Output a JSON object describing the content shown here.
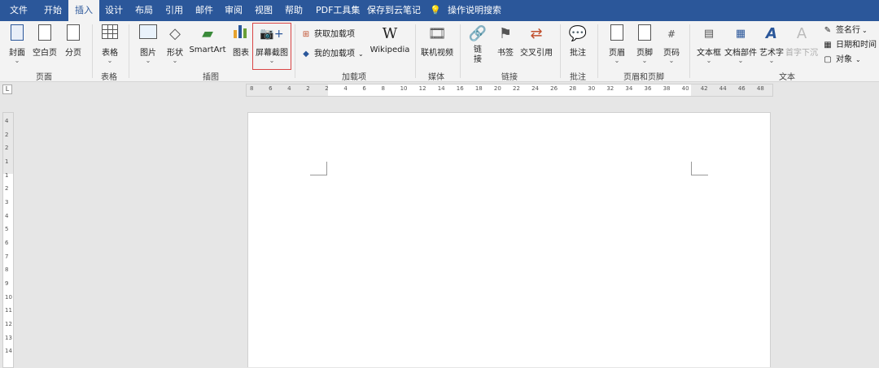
{
  "menu": {
    "file": "文件",
    "home": "开始",
    "insert": "插入",
    "design": "设计",
    "layout": "布局",
    "references": "引用",
    "mailings": "邮件",
    "review": "审阅",
    "view": "视图",
    "help": "帮助",
    "pdf": "PDF工具集",
    "save_cloud": "保存到云笔记",
    "search": "操作说明搜索"
  },
  "ribbon": {
    "pages": {
      "cover": "封面",
      "blank": "空白页",
      "break": "分页",
      "label": "页面"
    },
    "tables": {
      "table": "表格",
      "label": "表格"
    },
    "illustrations": {
      "picture": "图片",
      "shapes": "形状",
      "smartart": "SmartArt",
      "chart": "图表",
      "screenshot": "屏幕截图",
      "label": "插图"
    },
    "addins": {
      "get": "获取加载项",
      "mine": "我的加载项",
      "wikipedia": "Wikipedia",
      "label": "加载项"
    },
    "media": {
      "online_video": "联机视频",
      "label": "媒体"
    },
    "links": {
      "link": "链接",
      "bookmark": "书签",
      "crossref": "交叉引用",
      "label": "链接"
    },
    "comments": {
      "comment": "批注",
      "label": "批注"
    },
    "header_footer": {
      "header": "页眉",
      "footer": "页脚",
      "page_number": "页码",
      "label": "页眉和页脚"
    },
    "text": {
      "textbox": "文本框",
      "quickparts": "文档部件",
      "wordart": "艺术字",
      "dropcap": "首字下沉",
      "signature": "签名行",
      "datetime": "日期和时间",
      "object": "对象",
      "label": "文本"
    }
  },
  "ruler": {
    "h_ticks": [
      "8",
      "6",
      "4",
      "2",
      "2",
      "4",
      "6",
      "8",
      "10",
      "12",
      "14",
      "16",
      "18",
      "20",
      "22",
      "24",
      "26",
      "28",
      "30",
      "32",
      "34",
      "36",
      "38",
      "40",
      "42",
      "44",
      "46",
      "48"
    ],
    "v_ticks": [
      "4",
      "2",
      "2",
      "1",
      "1",
      "2",
      "3",
      "4",
      "5",
      "6",
      "7",
      "8",
      "9",
      "10",
      "11",
      "12",
      "13",
      "14"
    ]
  },
  "colors": {
    "accent": "#2b579a",
    "highlight": "#d94545"
  }
}
